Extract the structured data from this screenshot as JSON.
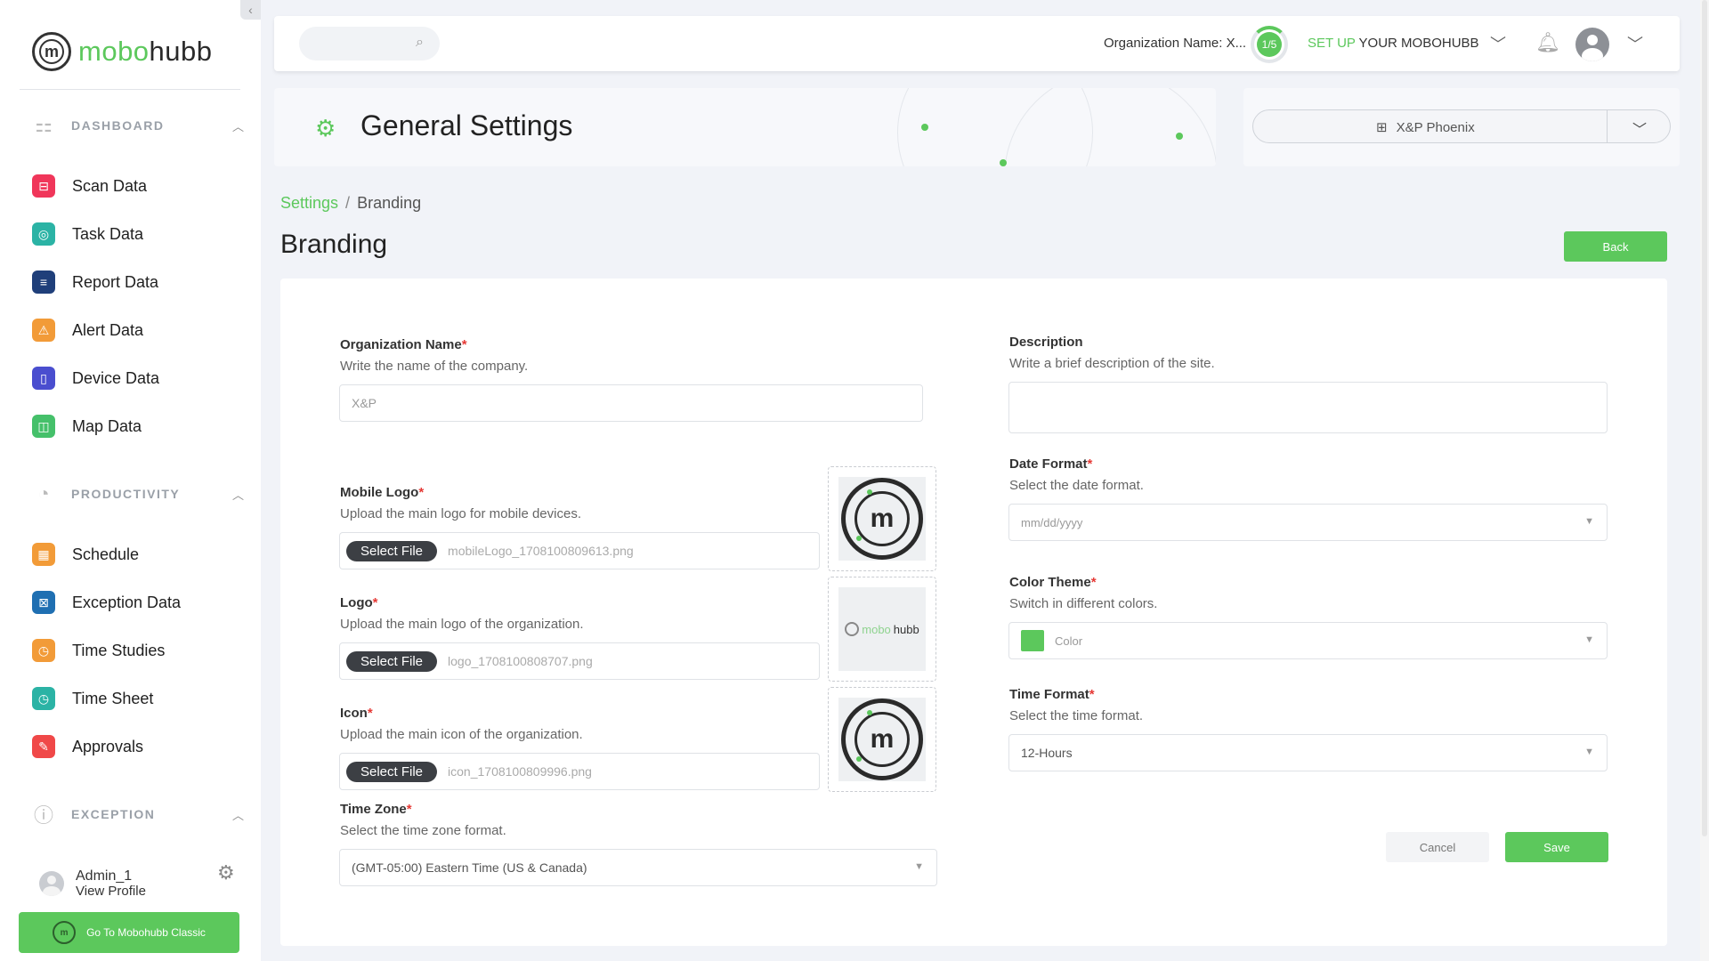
{
  "sidebar": {
    "brand": {
      "prefix": "mobo",
      "suffix": "hubb"
    },
    "sections": [
      {
        "title": "DASHBOARD",
        "items": [
          {
            "label": "Scan Data",
            "icon": "scan-icon",
            "color": "#f0365a"
          },
          {
            "label": "Task Data",
            "icon": "task-icon",
            "color": "#2bb3a5"
          },
          {
            "label": "Report Data",
            "icon": "report-icon",
            "color": "#1f3f7a"
          },
          {
            "label": "Alert Data",
            "icon": "alert-icon",
            "color": "#f29b38"
          },
          {
            "label": "Device Data",
            "icon": "device-icon",
            "color": "#4a4ecf"
          },
          {
            "label": "Map Data",
            "icon": "map-icon",
            "color": "#45c06a"
          }
        ]
      },
      {
        "title": "PRODUCTIVITY",
        "items": [
          {
            "label": "Schedule",
            "icon": "schedule-icon",
            "color": "#f29b38"
          },
          {
            "label": "Exception Data",
            "icon": "exception-icon",
            "color": "#1f6fb2"
          },
          {
            "label": "Time Studies",
            "icon": "time-studies-icon",
            "color": "#f29b38"
          },
          {
            "label": "Time Sheet",
            "icon": "time-sheet-icon",
            "color": "#2bb3a5"
          },
          {
            "label": "Approvals",
            "icon": "approvals-icon",
            "color": "#f04848"
          }
        ]
      },
      {
        "title": "EXCEPTION",
        "items": []
      }
    ],
    "user": {
      "name": "Admin_1",
      "link": "View Profile"
    },
    "classic_button": "Go To Mobohubb Classic"
  },
  "topbar": {
    "org_label": "Organization Name: X...",
    "progress": "1/5",
    "setup_prefix": "SET UP",
    "setup_suffix": "YOUR MOBOHUBB"
  },
  "header": {
    "title": "General Settings",
    "site_selector": "X&P Phoenix"
  },
  "breadcrumb": {
    "parent": "Settings",
    "separator": "/",
    "current": "Branding"
  },
  "page": {
    "title": "Branding",
    "back_label": "Back"
  },
  "form": {
    "organization_name": {
      "label": "Organization Name",
      "help": "Write the name of the company.",
      "value": "X&P"
    },
    "mobile_logo": {
      "label": "Mobile Logo",
      "help": "Upload the main logo for mobile devices.",
      "button": "Select File",
      "file": "mobileLogo_1708100809613.png"
    },
    "logo": {
      "label": "Logo",
      "help": "Upload the main logo of the organization.",
      "button": "Select File",
      "file": "logo_1708100808707.png"
    },
    "icon": {
      "label": "Icon",
      "help": "Upload the main icon of the organization.",
      "button": "Select File",
      "file": "icon_1708100809996.png"
    },
    "time_zone": {
      "label": "Time Zone",
      "help": "Select the time zone format.",
      "value": "(GMT-05:00) Eastern Time (US & Canada)"
    },
    "description": {
      "label": "Description",
      "help": "Write a brief description of the site.",
      "value": ""
    },
    "date_format": {
      "label": "Date Format",
      "help": "Select the date format.",
      "placeholder": "mm/dd/yyyy"
    },
    "color_theme": {
      "label": "Color Theme",
      "help": "Switch in different colors.",
      "placeholder": "Color",
      "swatch": "#5cc85c"
    },
    "time_format": {
      "label": "Time Format",
      "help": "Select the time format.",
      "value": "12-Hours"
    },
    "cancel_label": "Cancel",
    "save_label": "Save"
  },
  "colors": {
    "accent": "#5cc85c",
    "required": "#e53935"
  }
}
